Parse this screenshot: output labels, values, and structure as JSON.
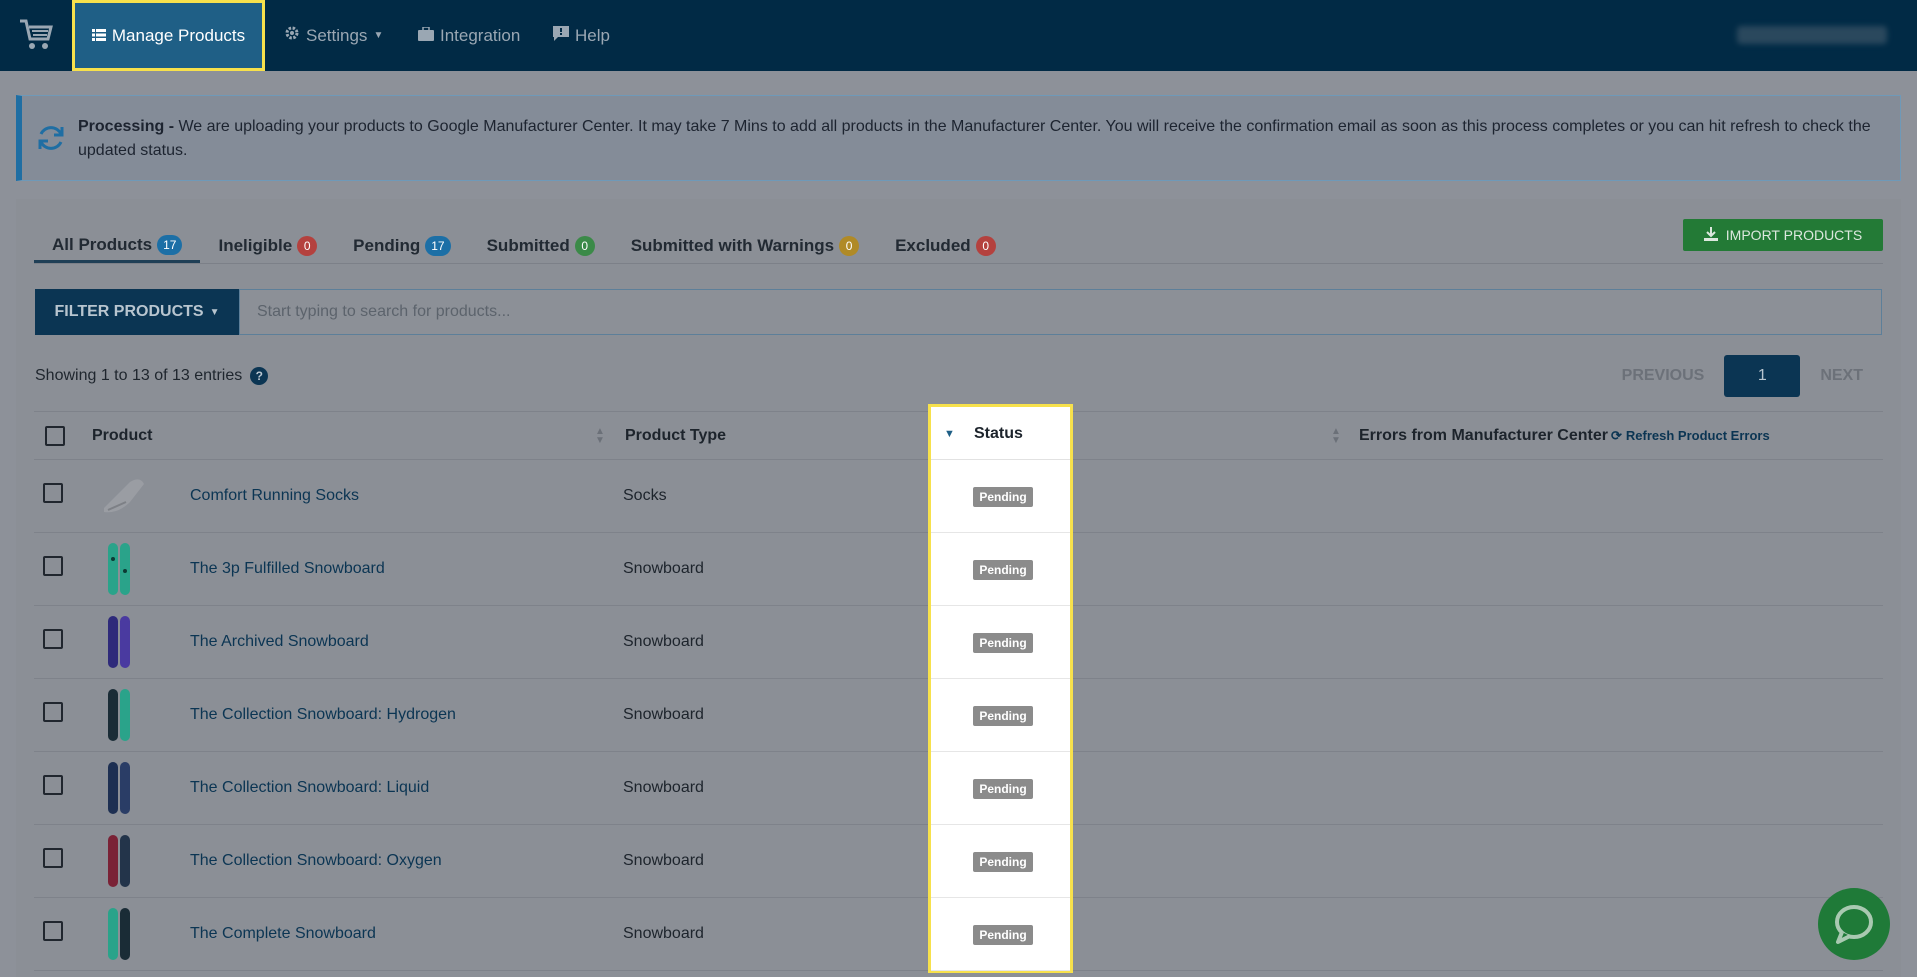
{
  "nav": {
    "items": [
      {
        "label": "Manage Products",
        "icon": "list-icon"
      },
      {
        "label": "Settings",
        "icon": "gear-icon"
      },
      {
        "label": "Integration",
        "icon": "briefcase-icon"
      },
      {
        "label": "Help",
        "icon": "chat-bubble-icon"
      }
    ],
    "account": "",
    "accent": "#f7e14c"
  },
  "alert": {
    "title": "Processing -",
    "message": " We are uploading your products to Google Manufacturer Center. It may take 7 Mins to add all products in the Manufacturer Center. You will receive the confirmation email as soon as this process completes or you can hit refresh to check the updated status."
  },
  "tabs": [
    {
      "label": "All Products",
      "count": "17"
    },
    {
      "label": "Ineligible",
      "count": "0"
    },
    {
      "label": "Pending",
      "count": "17"
    },
    {
      "label": "Submitted",
      "count": "0"
    },
    {
      "label": "Submitted with Warnings",
      "count": "0"
    },
    {
      "label": "Excluded",
      "count": "0"
    }
  ],
  "import_label": "IMPORT PRODUCTS",
  "filter_label": "FILTER PRODUCTS",
  "search_placeholder": "Start typing to search for products...",
  "showing_text": "Showing 1 to 13 of 13 entries",
  "pager": {
    "previous": "PREVIOUS",
    "page": "1",
    "next": "NEXT"
  },
  "table": {
    "headers": {
      "product": "Product",
      "product_type": "Product Type",
      "status": "Status",
      "errors": "Errors from Manufacturer Center",
      "refresh": "Refresh Product Errors"
    },
    "rows": [
      {
        "name": "Comfort Running Socks",
        "type": "Socks",
        "status": "Pending"
      },
      {
        "name": "The 3p Fulfilled Snowboard",
        "type": "Snowboard",
        "status": "Pending"
      },
      {
        "name": "The Archived Snowboard",
        "type": "Snowboard",
        "status": "Pending"
      },
      {
        "name": "The Collection Snowboard: Hydrogen",
        "type": "Snowboard",
        "status": "Pending"
      },
      {
        "name": "The Collection Snowboard: Liquid",
        "type": "Snowboard",
        "status": "Pending"
      },
      {
        "name": "The Collection Snowboard: Oxygen",
        "type": "Snowboard",
        "status": "Pending"
      },
      {
        "name": "The Complete Snowboard",
        "type": "Snowboard",
        "status": "Pending"
      }
    ]
  }
}
